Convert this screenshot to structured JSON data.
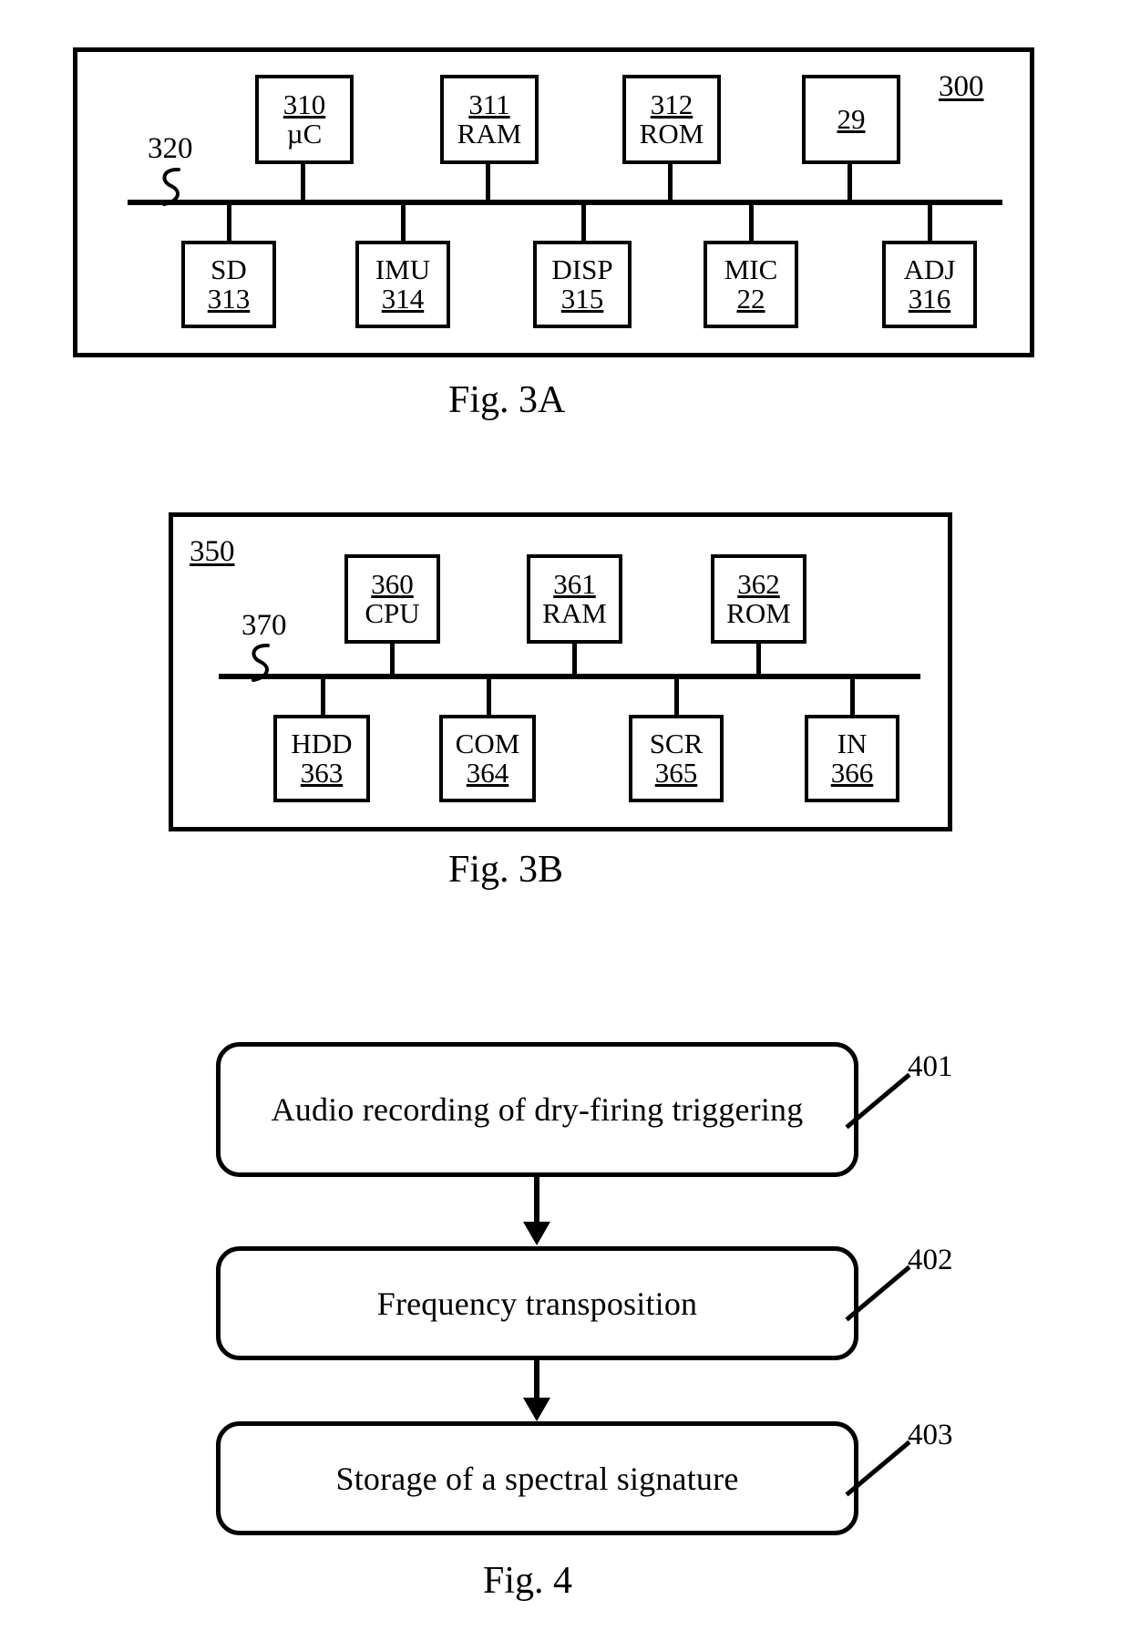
{
  "figures": [
    {
      "id": "fig3a",
      "caption": "Fig. 3A",
      "system_ref": "300",
      "bus_ref": "320",
      "top_nodes": [
        {
          "num": "310",
          "label": "µC"
        },
        {
          "num": "311",
          "label": "RAM"
        },
        {
          "num": "312",
          "label": "ROM"
        },
        {
          "num": "29",
          "label": ""
        }
      ],
      "bottom_nodes": [
        {
          "label": "SD",
          "num": "313"
        },
        {
          "label": "IMU",
          "num": "314"
        },
        {
          "label": "DISP",
          "num": "315"
        },
        {
          "label": "MIC",
          "num": "22"
        },
        {
          "label": "ADJ",
          "num": "316"
        }
      ]
    },
    {
      "id": "fig3b",
      "caption": "Fig. 3B",
      "system_ref": "350",
      "bus_ref": "370",
      "top_nodes": [
        {
          "num": "360",
          "label": "CPU"
        },
        {
          "num": "361",
          "label": "RAM"
        },
        {
          "num": "362",
          "label": "ROM"
        }
      ],
      "bottom_nodes": [
        {
          "label": "HDD",
          "num": "363"
        },
        {
          "label": "COM",
          "num": "364"
        },
        {
          "label": "SCR",
          "num": "365"
        },
        {
          "label": "IN",
          "num": "366"
        }
      ]
    }
  ],
  "fig4": {
    "caption": "Fig. 4",
    "steps": [
      {
        "text": "Audio recording of dry-firing triggering",
        "ref": "401"
      },
      {
        "text": "Frequency transposition",
        "ref": "402"
      },
      {
        "text": "Storage of a spectral signature",
        "ref": "403"
      }
    ]
  },
  "colors": {
    "ink": "#000000",
    "paper": "#ffffff"
  }
}
